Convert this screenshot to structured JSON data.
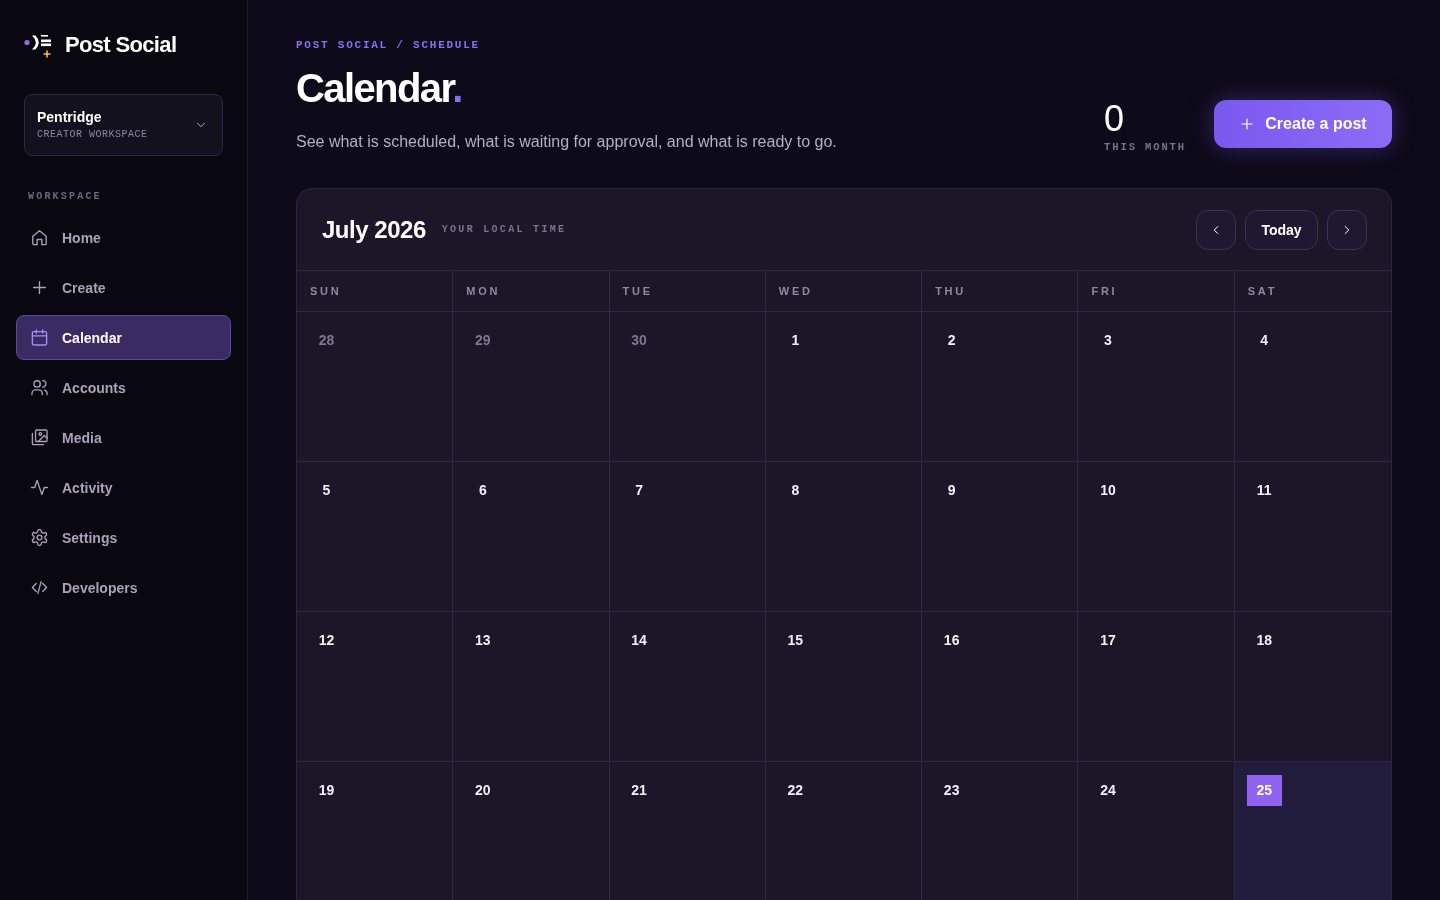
{
  "brand": {
    "name": "Post Social"
  },
  "workspace_switcher": {
    "name": "Pentridge",
    "subtitle": "CREATOR WORKSPACE"
  },
  "sidebar": {
    "section_label": "WORKSPACE",
    "items": [
      {
        "label": "Home",
        "selected": false
      },
      {
        "label": "Create",
        "selected": false
      },
      {
        "label": "Calendar",
        "selected": true
      },
      {
        "label": "Accounts",
        "selected": false
      },
      {
        "label": "Media",
        "selected": false
      },
      {
        "label": "Activity",
        "selected": false
      },
      {
        "label": "Settings",
        "selected": false
      },
      {
        "label": "Developers",
        "selected": false
      }
    ]
  },
  "header": {
    "breadcrumb": "POST SOCIAL / SCHEDULE",
    "title": "Calendar",
    "title_accent": ".",
    "subtitle": "See what is scheduled, what is waiting for approval, and what is ready to go.",
    "stat": {
      "value": "0",
      "label": "THIS MONTH"
    },
    "primary_button": "Create a post"
  },
  "calendar": {
    "month": "July 2026",
    "timezone_note": "YOUR LOCAL TIME",
    "today_button": "Today",
    "weekdays": [
      "SUN",
      "MON",
      "TUE",
      "WED",
      "THU",
      "FRI",
      "SAT"
    ],
    "weeks": [
      {
        "days": [
          {
            "day": "28",
            "outside_month": true,
            "today": false
          },
          {
            "day": "29",
            "outside_month": true,
            "today": false
          },
          {
            "day": "30",
            "outside_month": true,
            "today": false
          },
          {
            "day": "1",
            "outside_month": false,
            "today": false
          },
          {
            "day": "2",
            "outside_month": false,
            "today": false
          },
          {
            "day": "3",
            "outside_month": false,
            "today": false
          },
          {
            "day": "4",
            "outside_month": false,
            "today": false
          }
        ]
      },
      {
        "days": [
          {
            "day": "5",
            "outside_month": false,
            "today": false
          },
          {
            "day": "6",
            "outside_month": false,
            "today": false
          },
          {
            "day": "7",
            "outside_month": false,
            "today": false
          },
          {
            "day": "8",
            "outside_month": false,
            "today": false
          },
          {
            "day": "9",
            "outside_month": false,
            "today": false
          },
          {
            "day": "10",
            "outside_month": false,
            "today": false
          },
          {
            "day": "11",
            "outside_month": false,
            "today": false
          }
        ]
      },
      {
        "days": [
          {
            "day": "12",
            "outside_month": false,
            "today": false
          },
          {
            "day": "13",
            "outside_month": false,
            "today": false
          },
          {
            "day": "14",
            "outside_month": false,
            "today": false
          },
          {
            "day": "15",
            "outside_month": false,
            "today": false
          },
          {
            "day": "16",
            "outside_month": false,
            "today": false
          },
          {
            "day": "17",
            "outside_month": false,
            "today": false
          },
          {
            "day": "18",
            "outside_month": false,
            "today": false
          }
        ]
      },
      {
        "days": [
          {
            "day": "19",
            "outside_month": false,
            "today": false
          },
          {
            "day": "20",
            "outside_month": false,
            "today": false
          },
          {
            "day": "21",
            "outside_month": false,
            "today": false
          },
          {
            "day": "22",
            "outside_month": false,
            "today": false
          },
          {
            "day": "23",
            "outside_month": false,
            "today": false
          },
          {
            "day": "24",
            "outside_month": false,
            "today": false
          },
          {
            "day": "25",
            "outside_month": false,
            "today": true
          }
        ]
      }
    ]
  }
}
